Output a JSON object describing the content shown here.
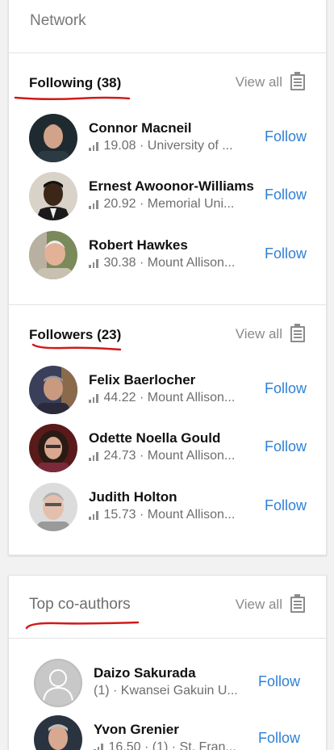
{
  "network_title": "Network",
  "following": {
    "title": "Following (38)",
    "view_all": "View all",
    "people": [
      {
        "name": "Connor Macneil",
        "score": "19.08",
        "affiliation": "University of ...",
        "follow": "Follow"
      },
      {
        "name": "Ernest Awoonor-Williams",
        "score": "20.92",
        "affiliation": "Memorial Uni...",
        "follow": "Follow"
      },
      {
        "name": "Robert Hawkes",
        "score": "30.38",
        "affiliation": "Mount Allison...",
        "follow": "Follow"
      }
    ]
  },
  "followers": {
    "title": "Followers (23)",
    "view_all": "View all",
    "people": [
      {
        "name": "Felix Baerlocher",
        "score": "44.22",
        "affiliation": "Mount Allison...",
        "follow": "Follow"
      },
      {
        "name": "Odette Noella Gould",
        "score": "24.73",
        "affiliation": "Mount Allison...",
        "follow": "Follow"
      },
      {
        "name": "Judith Holton",
        "score": "15.73",
        "affiliation": "Mount Allison...",
        "follow": "Follow"
      }
    ]
  },
  "coauthors": {
    "title": "Top co-authors",
    "view_all": "View all",
    "people": [
      {
        "name": "Daizo Sakurada",
        "meta": "(1) · Kwansei Gakuin U...",
        "follow": "Follow"
      },
      {
        "name": "Yvon Grenier",
        "meta": "16.50 · (1) · St. Fran...",
        "follow": "Follow"
      }
    ]
  },
  "colors": {
    "accent": "#2f80d6",
    "annotation": "#d11a1a",
    "muted": "#787878"
  }
}
